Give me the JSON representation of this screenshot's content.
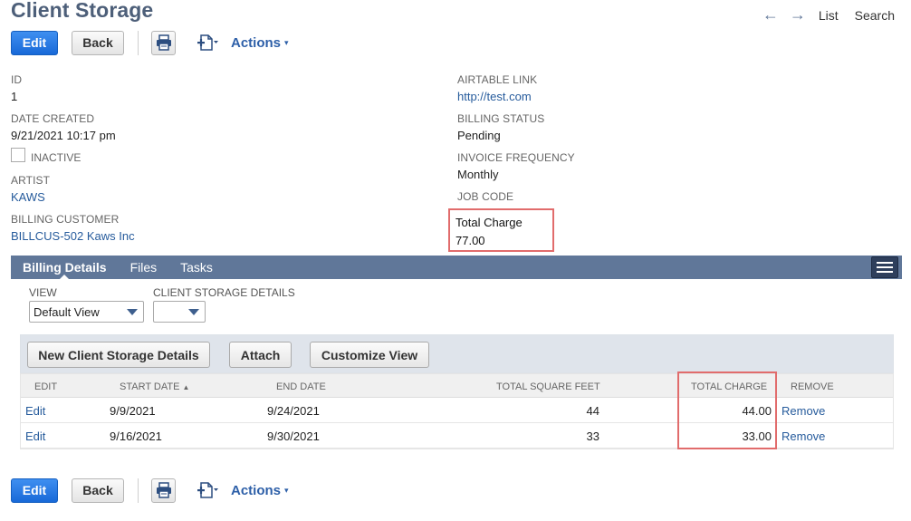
{
  "page": {
    "title": "Client Storage"
  },
  "topnav": {
    "back_arrow": "←",
    "forward_arrow": "→",
    "list": "List",
    "search": "Search"
  },
  "toolbar": {
    "edit": "Edit",
    "back": "Back",
    "actions": "Actions",
    "caret": "▾"
  },
  "fields": {
    "id": {
      "label": "ID",
      "value": "1"
    },
    "date_created": {
      "label": "DATE CREATED",
      "value": "9/21/2021 10:17 pm"
    },
    "inactive": {
      "label": "INACTIVE"
    },
    "artist": {
      "label": "ARTIST",
      "value": "KAWS"
    },
    "billing_customer": {
      "label": "BILLING CUSTOMER",
      "value": "BILLCUS-502 Kaws Inc"
    },
    "airtable_link": {
      "label": "AIRTABLE LINK",
      "value": "http://test.com"
    },
    "billing_status": {
      "label": "BILLING STATUS",
      "value": "Pending"
    },
    "invoice_frequency": {
      "label": "INVOICE FREQUENCY",
      "value": "Monthly"
    },
    "job_code": {
      "label": "JOB CODE",
      "value": ""
    },
    "total_charge": {
      "label": "Total Charge",
      "value": "77.00"
    }
  },
  "tabs": [
    {
      "label": "Billing Details",
      "active": true
    },
    {
      "label": "Files",
      "active": false
    },
    {
      "label": "Tasks",
      "active": false
    }
  ],
  "sublist": {
    "view_label": "VIEW",
    "view_value": "Default View",
    "csd_label": "CLIENT STORAGE DETAILS",
    "csd_value": "",
    "buttons": {
      "new": "New Client Storage Details",
      "attach": "Attach",
      "customize": "Customize View"
    },
    "columns": {
      "edit": "EDIT",
      "start_date": "START DATE",
      "sort_indicator": "▲",
      "end_date": "END DATE",
      "total_square_feet": "TOTAL SQUARE FEET",
      "total_charge": "TOTAL CHARGE",
      "remove": "REMOVE"
    },
    "rows": [
      {
        "edit": "Edit",
        "start_date": "9/9/2021",
        "end_date": "9/24/2021",
        "total_square_feet": "44",
        "total_charge": "44.00",
        "remove": "Remove"
      },
      {
        "edit": "Edit",
        "start_date": "9/16/2021",
        "end_date": "9/30/2021",
        "total_square_feet": "33",
        "total_charge": "33.00",
        "remove": "Remove"
      }
    ]
  },
  "colors": {
    "accent": "#1b73e0",
    "title": "#4d5f79",
    "tabbar": "#607799",
    "link": "#265b9c",
    "highlight": "#e16c6c"
  }
}
